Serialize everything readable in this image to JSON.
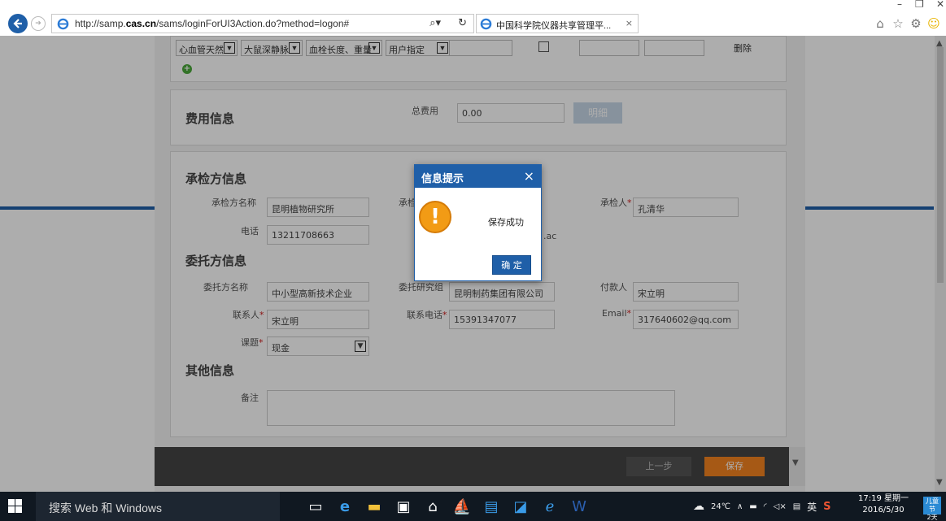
{
  "browser": {
    "url_prefix": "http://samp.",
    "url_domain": "cas.cn",
    "url_suffix": "/sams/loginForUI3Action.do?method=logon#",
    "tab_title": "中国科学院仪器共享管理平...",
    "tab_close": "×"
  },
  "sample_row": {
    "col1": "心血管天然",
    "col2": "大鼠深静脉",
    "col3": "血栓长度、重量",
    "col4": "用户指定",
    "delete": "删除"
  },
  "fee": {
    "heading": "费用信息",
    "total_label": "总费用",
    "total_value": "0.00",
    "detail_button": "明细"
  },
  "inspector": {
    "heading": "承检方信息",
    "name_label": "承检方名称",
    "name_value": "昆明植物研究所",
    "org_label": "承检",
    "person_label": "承检人",
    "person_value": "孔清华",
    "phone_label": "电话",
    "phone_value": "13211708663",
    "email_tail": ".ac"
  },
  "client": {
    "heading": "委托方信息",
    "name_label": "委托方名称",
    "name_value": "中小型高新技术企业",
    "group_label": "委托研究组",
    "group_value": "昆明制药集团有限公司",
    "payer_label": "付款人",
    "payer_value": "宋立明",
    "contact_label": "联系人",
    "contact_value": "宋立明",
    "phone_label": "联系电话",
    "phone_value": "15391347077",
    "email_label": "Email",
    "email_value": "317640602@qq.com",
    "topic_label": "课题",
    "topic_value": "现金"
  },
  "other": {
    "heading": "其他信息",
    "remark_label": "备注"
  },
  "required_mark": "*",
  "footer": {
    "prev_button": "上一步",
    "save_button": "保存"
  },
  "dialog": {
    "title": "信息提示",
    "message": "保存成功",
    "ok_button": "确 定",
    "close": "×"
  },
  "taskbar": {
    "search_placeholder": "搜索 Web 和 Windows",
    "temperature": "24℃",
    "ime": "英",
    "time": "17:19 星期一",
    "date": "2016/5/30",
    "badge_line1": "儿童节",
    "badge_line2": "2天"
  },
  "colors": {
    "accent": "#1f5fa8",
    "save": "#f5841f",
    "required": "#d02020"
  }
}
